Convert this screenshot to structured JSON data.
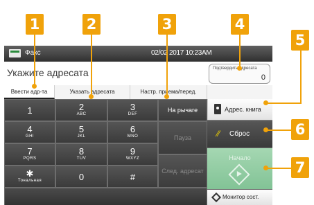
{
  "callouts": [
    "1",
    "2",
    "3",
    "4",
    "5",
    "6",
    "7"
  ],
  "header": {
    "title": "Факс",
    "datetime": "02/02 2017 10:23AM"
  },
  "entry": {
    "prompt": "Укажите адресата",
    "counter_label": "Подтвердить адресата",
    "counter_value": "0"
  },
  "tabs": [
    {
      "label": "Ввести адр-та",
      "active": true
    },
    {
      "label": "Указать адресата",
      "active": false
    },
    {
      "label": "Настр. приема/перед.",
      "active": false
    }
  ],
  "keypad": [
    {
      "num": "1",
      "sub": ""
    },
    {
      "num": "2",
      "sub": "ABC"
    },
    {
      "num": "3",
      "sub": "DEF"
    },
    {
      "num": "4",
      "sub": "GHI"
    },
    {
      "num": "5",
      "sub": "JKL"
    },
    {
      "num": "6",
      "sub": "MNO"
    },
    {
      "num": "7",
      "sub": "PQRS"
    },
    {
      "num": "8",
      "sub": "TUV"
    },
    {
      "num": "9",
      "sub": "WXYZ"
    },
    {
      "num": "✱",
      "sub": "Тональная"
    },
    {
      "num": "0",
      "sub": ""
    },
    {
      "num": "#",
      "sub": ""
    }
  ],
  "side_buttons": {
    "on_hook": "На рычаге",
    "pause": "Пауза",
    "next_recipient": "След. адресат"
  },
  "actions": {
    "address_book": "Адрес. книга",
    "reset": "Сброс",
    "start": "Начало",
    "status_monitor": "Монитор сост."
  },
  "icons": {
    "fax": "fax-icon",
    "address_book": "address-book-icon",
    "reset": "reset-icon",
    "start": "start-icon",
    "monitor": "status-monitor-icon"
  },
  "colors": {
    "callout": "#f0a20a",
    "start": "#8ccc9e",
    "reset_icon": "#f2d400"
  }
}
